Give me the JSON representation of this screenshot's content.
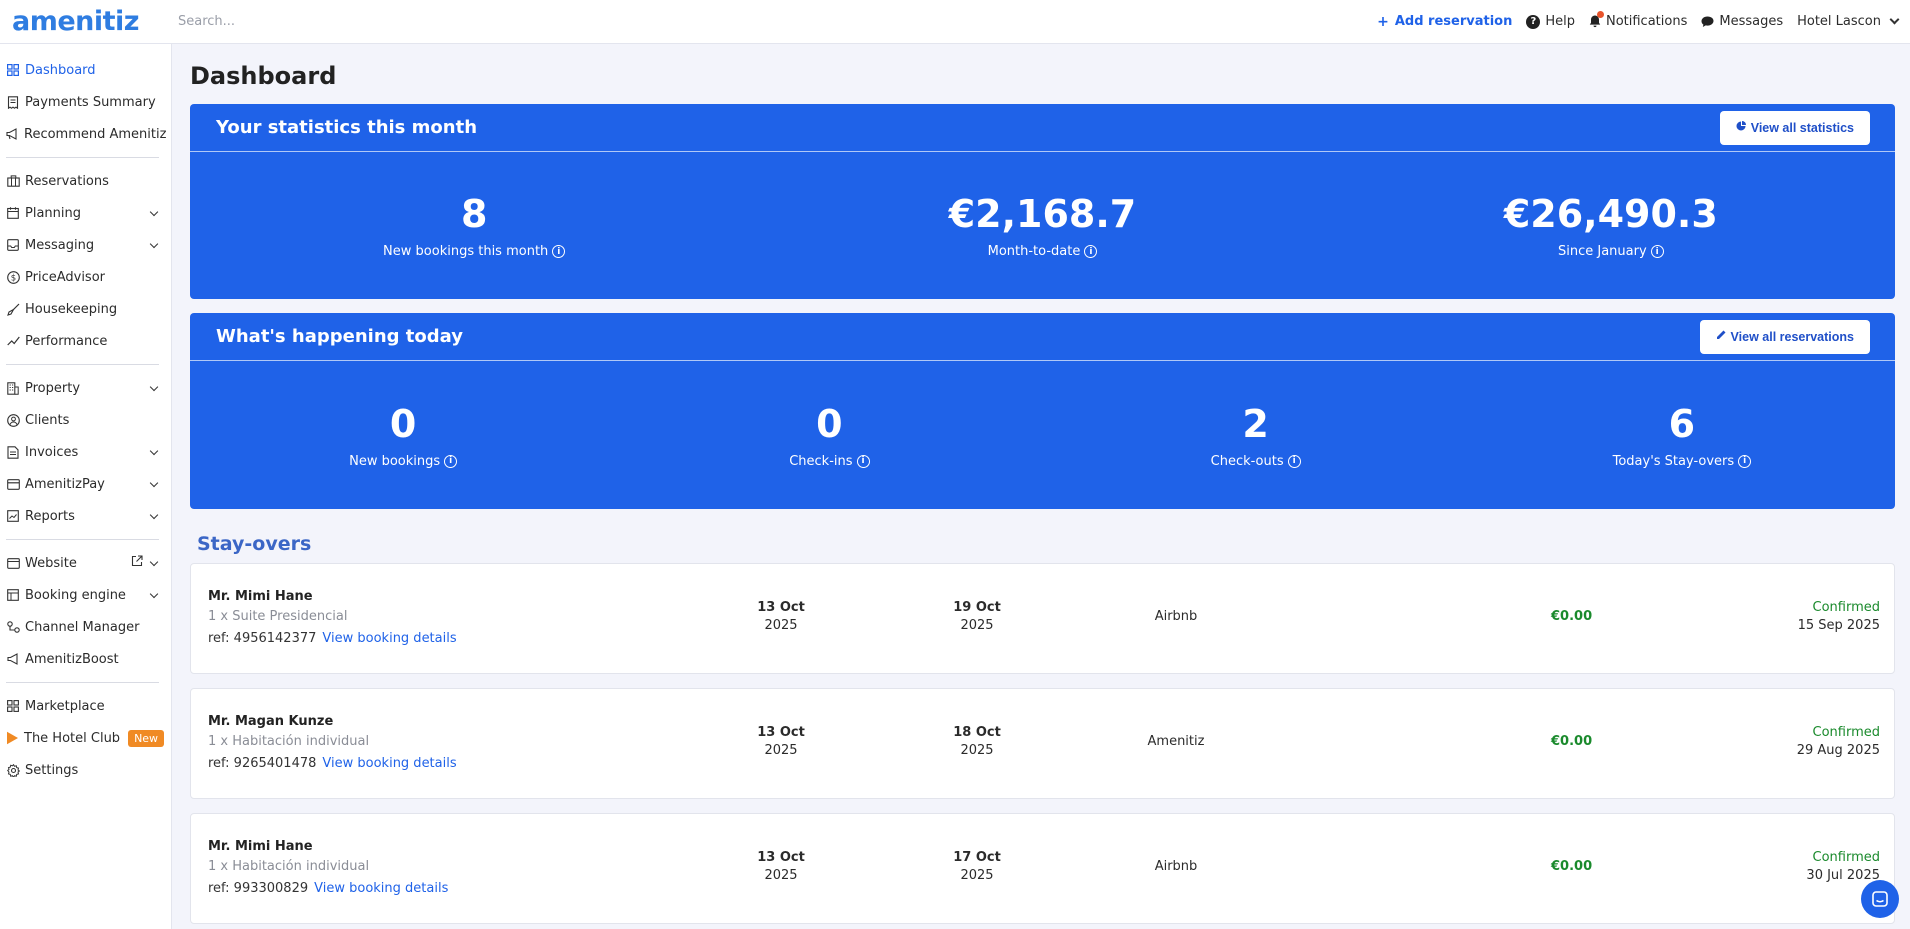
{
  "brand": {
    "logo": "amenitiz",
    "accent": "#1f62e8"
  },
  "topbar": {
    "search_placeholder": "Search...",
    "add_reservation": "Add reservation",
    "help": "Help",
    "notifications": "Notifications",
    "messages": "Messages",
    "hotel": "Hotel Lascon"
  },
  "sidebar": {
    "items": [
      {
        "label": "Dashboard",
        "icon": "grid-icon",
        "active": true
      },
      {
        "label": "Payments Summary",
        "icon": "receipt-icon"
      },
      {
        "label": "Recommend Amenitiz",
        "icon": "megaphone-icon"
      },
      {
        "label": "Reservations",
        "icon": "building-icon"
      },
      {
        "label": "Planning",
        "icon": "calendar-icon",
        "expandable": true
      },
      {
        "label": "Messaging",
        "icon": "inbox-icon",
        "expandable": true
      },
      {
        "label": "PriceAdvisor",
        "icon": "dollar-icon"
      },
      {
        "label": "Housekeeping",
        "icon": "broom-icon"
      },
      {
        "label": "Performance",
        "icon": "trend-icon"
      },
      {
        "label": "Property",
        "icon": "hotel-icon",
        "expandable": true
      },
      {
        "label": "Clients",
        "icon": "clients-icon"
      },
      {
        "label": "Invoices",
        "icon": "invoice-icon",
        "expandable": true
      },
      {
        "label": "AmenitizPay",
        "icon": "card-icon",
        "expandable": true
      },
      {
        "label": "Reports",
        "icon": "chart-icon",
        "expandable": true
      },
      {
        "label": "Website",
        "icon": "browser-icon",
        "expandable": true
      },
      {
        "label": "Booking engine",
        "icon": "booking-icon",
        "expandable": true
      },
      {
        "label": "Channel Manager",
        "icon": "channels-icon"
      },
      {
        "label": "AmenitizBoost",
        "icon": "boost-icon"
      },
      {
        "label": "Marketplace",
        "icon": "marketplace-icon"
      },
      {
        "label": "The Hotel Club",
        "icon": "play-icon",
        "badge": "New"
      },
      {
        "label": "Settings",
        "icon": "gear-icon"
      }
    ]
  },
  "page": {
    "title": "Dashboard"
  },
  "stats_month": {
    "title": "Your statistics this month",
    "button": "View all statistics",
    "items": [
      {
        "value": "8",
        "label": "New bookings this month"
      },
      {
        "value": "€2,168.7",
        "label": "Month-to-date"
      },
      {
        "value": "€26,490.3",
        "label": "Since January"
      }
    ]
  },
  "today": {
    "title": "What's happening today",
    "button": "View all reservations",
    "items": [
      {
        "value": "0",
        "label": "New bookings"
      },
      {
        "value": "0",
        "label": "Check-ins"
      },
      {
        "value": "2",
        "label": "Check-outs"
      },
      {
        "value": "6",
        "label": "Today's Stay-overs"
      }
    ]
  },
  "stayovers": {
    "title": "Stay-overs",
    "link_label": "View booking details",
    "rows": [
      {
        "name": "Mr. Mimi Hane",
        "room": "1 x Suite Presidencial",
        "ref": "ref: 4956142377",
        "in_day": "13 Oct",
        "in_year": "2025",
        "out_day": "19 Oct",
        "out_year": "2025",
        "source": "Airbnb",
        "amount": "€0.00",
        "status": "Confirmed",
        "status_date": "15 Sep 2025"
      },
      {
        "name": "Mr. Magan Kunze",
        "room": "1 x Habitación individual",
        "ref": "ref: 9265401478",
        "in_day": "13 Oct",
        "in_year": "2025",
        "out_day": "18 Oct",
        "out_year": "2025",
        "source": "Amenitiz",
        "amount": "€0.00",
        "status": "Confirmed",
        "status_date": "29 Aug 2025"
      },
      {
        "name": "Mr. Mimi Hane",
        "room": "1 x Habitación individual",
        "ref": "ref: 993300829",
        "in_day": "13 Oct",
        "in_year": "2025",
        "out_day": "17 Oct",
        "out_year": "2025",
        "source": "Airbnb",
        "amount": "€0.00",
        "status": "Confirmed",
        "status_date": "30 Jul 2025"
      }
    ]
  }
}
